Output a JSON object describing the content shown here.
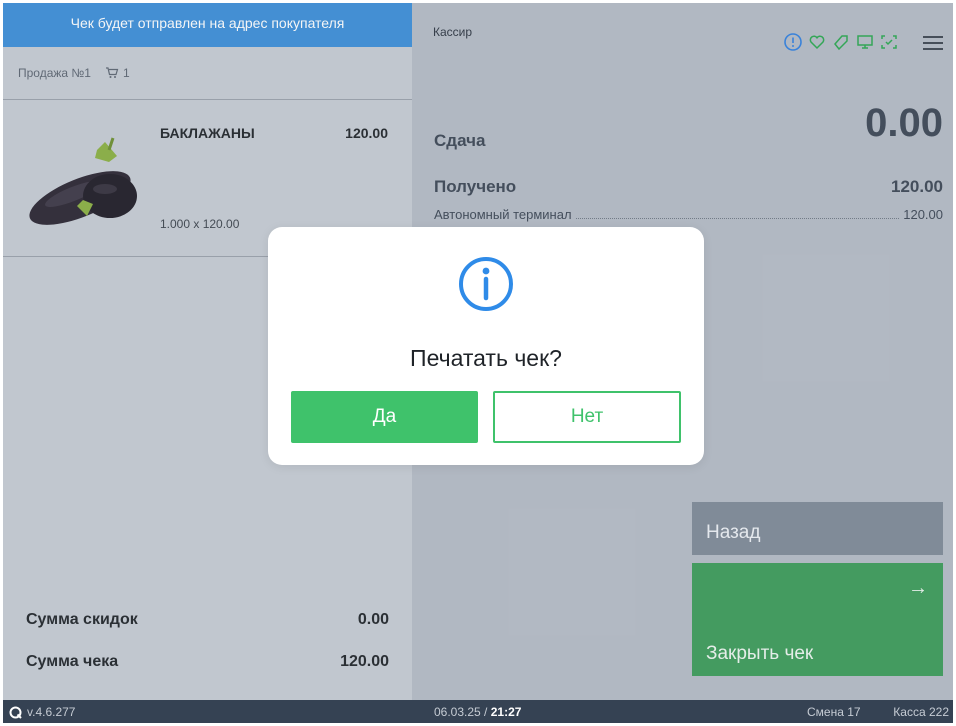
{
  "banner": {
    "text": "Чек будет отправлен на адрес покупателя"
  },
  "sale": {
    "title": "Продажа №1",
    "cart_count": "1"
  },
  "items": [
    {
      "name": "БАКЛАЖАНЫ",
      "price": "120.00",
      "qty": "1.000 x 120.00",
      "image_icon": "eggplant-image"
    }
  ],
  "totals": {
    "discount_label": "Сумма скидок",
    "discount_value": "0.00",
    "total_label": "Сумма чека",
    "total_value": "120.00"
  },
  "header": {
    "cashier": "Кассир",
    "status_icons": [
      "alert-circle-icon",
      "heart-icon",
      "tag-icon",
      "monitor-icon",
      "scan-icon"
    ],
    "menu_icon": "hamburger-menu-icon"
  },
  "payment": {
    "change_label": "Сдача",
    "change_value": "0.00",
    "received_label": "Получено",
    "received_value": "120.00",
    "terminal_label": "Автономный терминал",
    "terminal_value": "120.00"
  },
  "actions": {
    "back_label": "Назад",
    "close_label": "Закрыть чек",
    "close_arrow": "→"
  },
  "footer": {
    "version": "v.4.6.277",
    "date": "06.03.25 / ",
    "time": "21:27",
    "shift": "Смена 17",
    "register": "Касса 222"
  },
  "dialog": {
    "title": "Печатать чек?",
    "yes_label": "Да",
    "no_label": "Нет",
    "icon": "info-icon"
  },
  "colors": {
    "accent_blue": "#3b8ed8",
    "accent_green": "#3fc26b",
    "close_green": "#3c9b58",
    "footer_bg": "#354253"
  }
}
